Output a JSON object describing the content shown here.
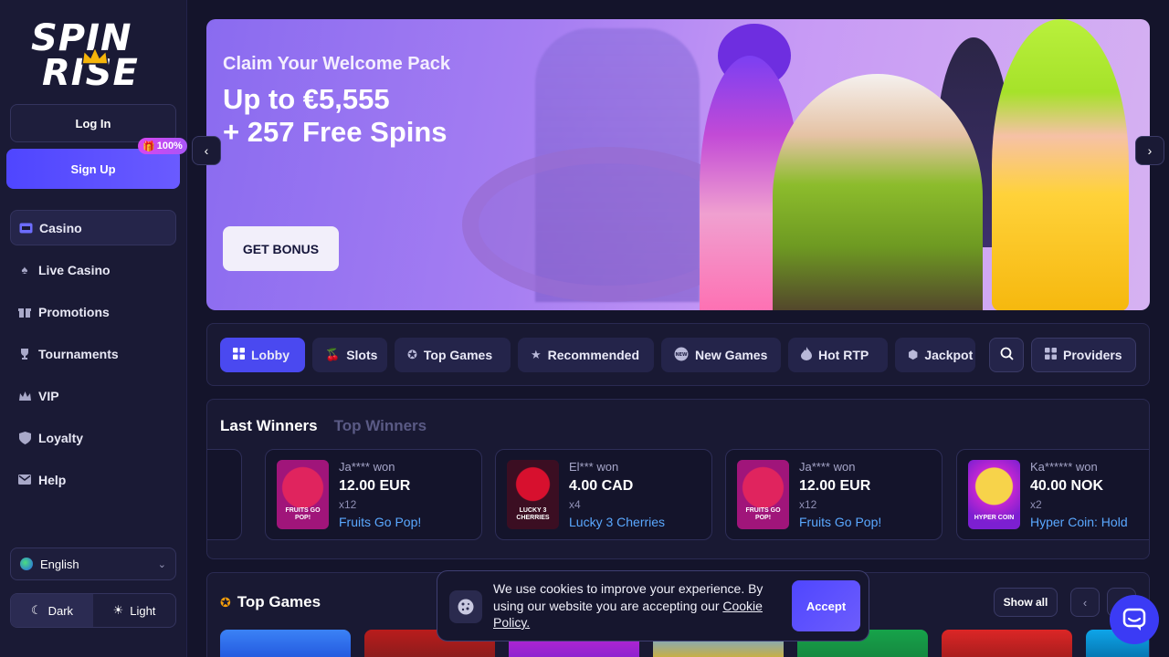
{
  "brand": {
    "line1": "SPIN",
    "line2": "RISE"
  },
  "auth": {
    "login_label": "Log In",
    "signup_label": "Sign Up",
    "signup_badge": "100%"
  },
  "nav": {
    "items": [
      {
        "label": "Casino",
        "icon": "casino-icon",
        "active": true
      },
      {
        "label": "Live Casino",
        "icon": "spade-icon"
      },
      {
        "label": "Promotions",
        "icon": "gift-icon"
      },
      {
        "label": "Tournaments",
        "icon": "trophy-icon"
      },
      {
        "label": "VIP",
        "icon": "crown-icon"
      },
      {
        "label": "Loyalty",
        "icon": "shield-icon"
      },
      {
        "label": "Help",
        "icon": "mail-icon"
      }
    ]
  },
  "language": {
    "selected": "English"
  },
  "theme": {
    "dark_label": "Dark",
    "light_label": "Light",
    "selected": "Dark"
  },
  "banner": {
    "subtitle": "Claim Your Welcome Pack",
    "title_line1": "Up to €5,555",
    "title_line2": "+ 257 Free Spins",
    "cta": "GET BONUS"
  },
  "categories": {
    "tabs": [
      {
        "label": "Lobby",
        "icon": "grid-icon",
        "active": true
      },
      {
        "label": "Slots",
        "icon": "cherry-icon"
      },
      {
        "label": "Top Games",
        "icon": "medal-icon"
      },
      {
        "label": "Recommended",
        "icon": "star-icon"
      },
      {
        "label": "New Games",
        "icon": "new-icon"
      },
      {
        "label": "Hot RTP",
        "icon": "flame-icon"
      },
      {
        "label": "Jackpot",
        "icon": "jackpot-icon"
      }
    ],
    "providers_label": "Providers"
  },
  "winners": {
    "tab_last": "Last Winners",
    "tab_top": "Top Winners",
    "cards": [
      {
        "who": "Ja**** won",
        "amount": "12.00 EUR",
        "multiplier": "x12",
        "game": "Fruits Go Pop!",
        "thumb_text": "FRUITS GO POP!"
      },
      {
        "who": "El*** won",
        "amount": "4.00 CAD",
        "multiplier": "x4",
        "game": "Lucky 3 Cherries",
        "thumb_text": "LUCKY 3 CHERRIES"
      },
      {
        "who": "Ja**** won",
        "amount": "12.00 EUR",
        "multiplier": "x12",
        "game": "Fruits Go Pop!",
        "thumb_text": "FRUITS GO POP!"
      },
      {
        "who": "Ka****** won",
        "amount": "40.00 NOK",
        "multiplier": "x2",
        "game": "Hyper Coin: Hold",
        "thumb_text": "HYPER COIN"
      }
    ]
  },
  "top_games": {
    "title": "Top Games",
    "show_all": "Show all"
  },
  "cookie": {
    "text_before": "We use cookies to improve your experience. By using our website you are accepting our ",
    "link": "Cookie Policy.",
    "accept": "Accept"
  },
  "colors": {
    "accent": "#4a49f0",
    "background": "#14142b",
    "link": "#5aa8ff"
  }
}
